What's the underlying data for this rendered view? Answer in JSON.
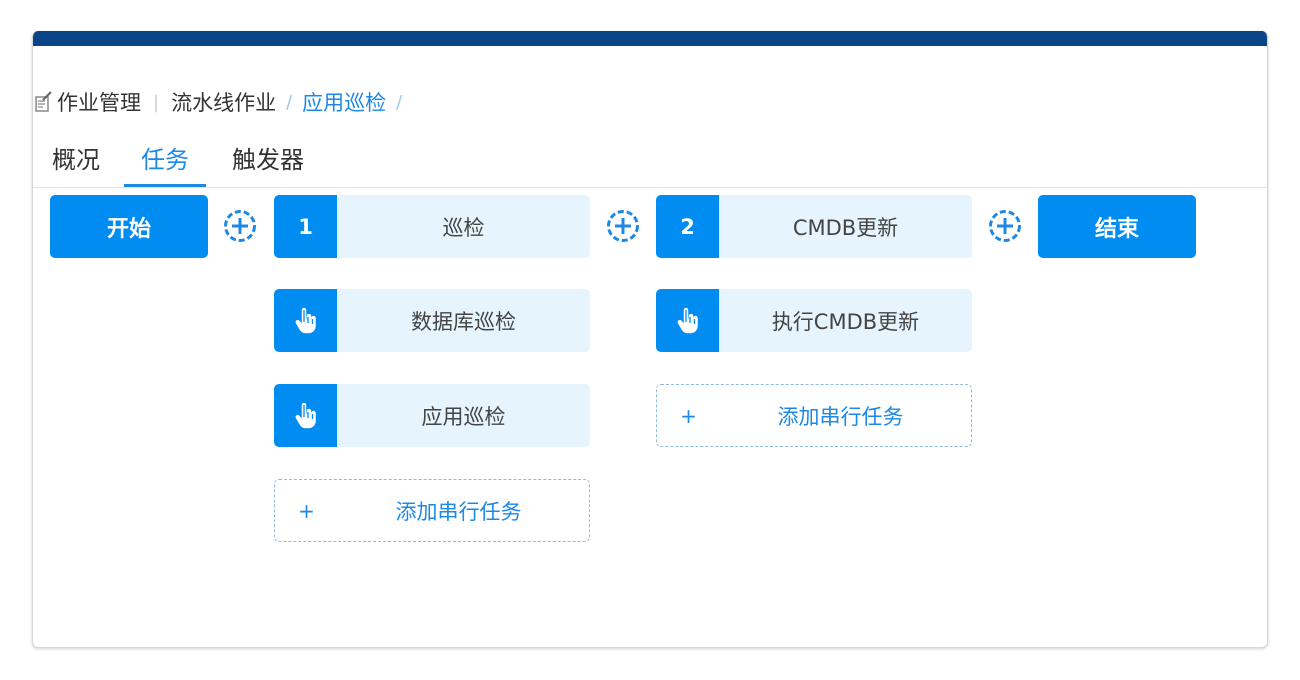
{
  "breadcrumb": {
    "icon": "document-pen-icon",
    "items": [
      "作业管理",
      "流水线作业",
      "应用巡检"
    ],
    "sep": "|",
    "slash": "/"
  },
  "tabs": [
    {
      "label": "概况",
      "active": false
    },
    {
      "label": "任务",
      "active": true
    },
    {
      "label": "触发器",
      "active": false
    }
  ],
  "pipeline": {
    "start_label": "开始",
    "end_label": "结束",
    "stages": [
      {
        "number": "1",
        "name": "巡检",
        "tasks": [
          "数据库巡检",
          "应用巡检"
        ],
        "add_label": "添加串行任务",
        "add_plus": "+"
      },
      {
        "number": "2",
        "name": "CMDB更新",
        "tasks": [
          "执行CMDB更新"
        ],
        "add_label": "添加串行任务",
        "add_plus": "+"
      }
    ]
  },
  "colors": {
    "accent": "#008cf0",
    "header_bar": "#0a4587",
    "task_bg": "#e6f5fd",
    "link": "#1e88e5"
  }
}
